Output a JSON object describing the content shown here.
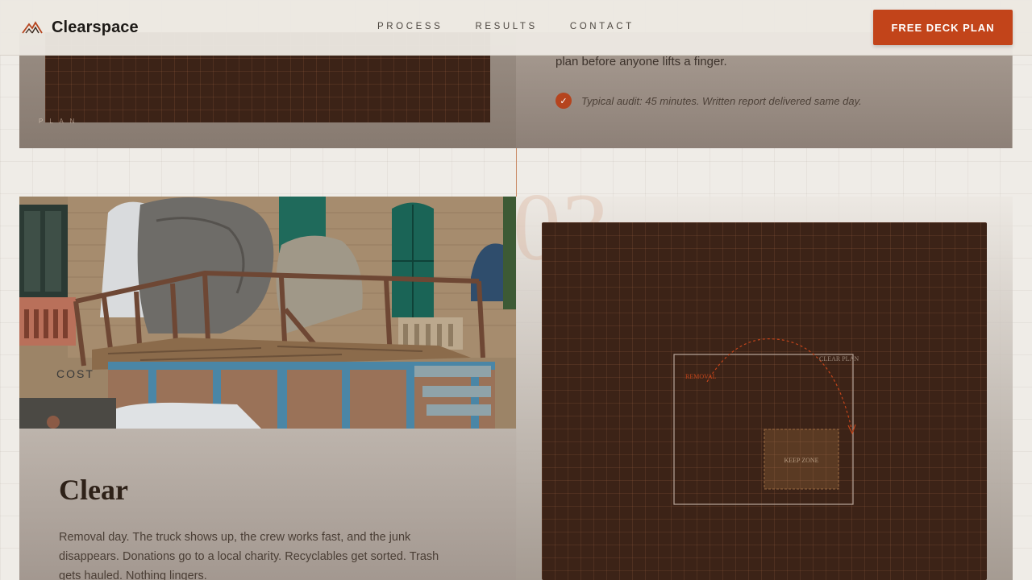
{
  "brand": {
    "name": "Clearspace",
    "accent": "#c2441a"
  },
  "nav": {
    "items": [
      "PROCESS",
      "RESULTS",
      "CONTACT"
    ]
  },
  "header": {
    "cta_label": "FREE DECK PLAN"
  },
  "previous_step": {
    "plan_caption": "P L A N",
    "text": "plan before anyone lifts a finger.",
    "note": "Typical audit: 45 minutes. Written report delivered same day."
  },
  "step": {
    "number": "03",
    "photo_label": "COST",
    "title": "Clear",
    "body": "Removal day. The truck shows up, the crew works fast, and the junk disappears. Donations go to a local charity. Recyclables get sorted. Trash gets hauled. Nothing lingers."
  },
  "plan_diagram": {
    "label_removal": "REMOVAL",
    "label_clear_plan": "CLEAR PLAN",
    "label_keep_zone": "KEEP ZONE"
  }
}
